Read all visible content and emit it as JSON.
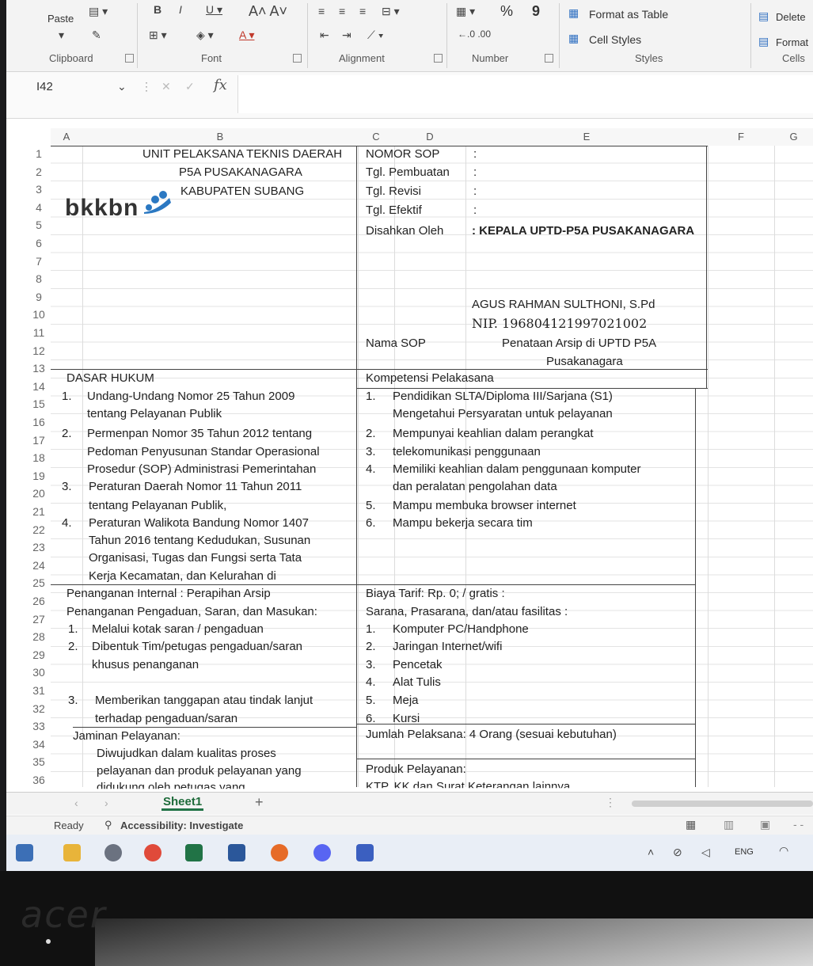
{
  "ribbon": {
    "paste": "Paste",
    "format_as_table": "Format as Table",
    "cell_styles": "Cell Styles",
    "delete": "Delete",
    "format": "Format",
    "groups": [
      "Clipboard",
      "Font",
      "Alignment",
      "Number",
      "Styles",
      "Cells"
    ],
    "number_percent": "%",
    "number_comma": "9"
  },
  "formula_bar": {
    "name_box": "I42",
    "fx": "fx",
    "value": ""
  },
  "columns": [
    "A",
    "B",
    "C",
    "D",
    "E",
    "F",
    "G"
  ],
  "rows": [
    "1",
    "2",
    "3",
    "4",
    "5",
    "6",
    "7",
    "8",
    "9",
    "10",
    "11",
    "12",
    "13",
    "14",
    "15",
    "16",
    "17",
    "18",
    "19",
    "20",
    "21",
    "22",
    "23",
    "24",
    "25",
    "26",
    "27",
    "28",
    "29",
    "30",
    "31",
    "32",
    "33",
    "34",
    "35",
    "36"
  ],
  "header": {
    "org_line1": "UNIT PELAKSANA  TEKNIS DAERAH",
    "org_line2": "P5A PUSAKANAGARA",
    "org_line3": "KABUPATEN SUBANG",
    "logo_text": "bkkbn"
  },
  "sop_info": {
    "nomor_label": "NOMOR SOP",
    "nomor_value": ":",
    "pembuatan_label": "Tgl. Pembuatan",
    "pembuatan_value": ":",
    "revisi_label": "Tgl. Revisi",
    "revisi_value": ":",
    "efektif_label": "Tgl. Efektif",
    "efektif_value": ":",
    "disahkan_label": "Disahkan Oleh",
    "disahkan_value": ": KEPALA UPTD-P5A PUSAKANAGARA",
    "signer_name": "AGUS RAHMAN SULTHONI, S.Pd",
    "signer_nip": "NIP. 196804121997021002",
    "nama_label": "Nama SOP",
    "nama_line1": "Penataan Arsip di UPTD P5A",
    "nama_line2": "Pusakanagara"
  },
  "left": {
    "dasar_hukum": "DASAR HUKUM",
    "r14_no": "1.",
    "r14": "Undang-Undang Nomor 25 Tahun 2009",
    "r15": "tentang Pelayanan Publik",
    "r16_no": "2.",
    "r16": "Permenpan Nomor 35 Tahun 2012 tentang",
    "r17": "Pedoman Penyusunan Standar Operasional",
    "r18": "Prosedur (SOP) Administrasi Pemerintahan",
    "r19_no": "3.",
    "r19": "Peraturan Daerah Nomor 11 Tahun 2011",
    "r20": "tentang Pelayanan Publik,",
    "r21_no": "4.",
    "r21": "Peraturan Walikota Bandung Nomor 1407",
    "r22": "Tahun 2016 tentang Kedudukan, Susunan",
    "r23": "Organisasi, Tugas dan Fungsi serta Tata",
    "r24": "Kerja Kecamatan, dan Kelurahan di",
    "r25": "Penanganan Internal : Perapihan Arsip",
    "r26": "Penanganan Pengaduan, Saran, dan Masukan:",
    "r27_no": "1.",
    "r27": "Melalui kotak saran / pengaduan",
    "r28_no": "2.",
    "r28": "Dibentuk Tim/petugas pengaduan/saran",
    "r29": "khusus penanganan",
    "r31_no": "3.",
    "r31": "Memberikan tanggapan atau tindak lanjut",
    "r32": "terhadap pengaduan/saran",
    "r33": "Jaminan Pelayanan:",
    "r34": "Diwujudkan dalam kualitas proses",
    "r35": "pelayanan dan produk pelayanan yang",
    "r36": "didukung oleh petugas yang"
  },
  "right": {
    "kompetensi": "Kompetensi Pelakasana",
    "r14_no": "1.",
    "r14": "Pendidikan SLTA/Diploma III/Sarjana (S1)",
    "r15": "Mengetahui Persyaratan untuk pelayanan",
    "r16_no": "2.",
    "r16": "Mempunyai keahlian dalam perangkat",
    "r17_no": "3.",
    "r17": "telekomunikasi penggunaan",
    "r18_no": "4.",
    "r18": "Memiliki keahlian dalam penggunaan komputer",
    "r19": "dan peralatan pengolahan data",
    "r20_no": "5.",
    "r20": "Mampu membuka browser internet",
    "r21_no": "6.",
    "r21": "Mampu bekerja secara tim",
    "r25": "Biaya Tarif: Rp. 0; / gratis :",
    "r26": "Sarana, Prasarana, dan/atau fasilitas :",
    "r27_no": "1.",
    "r27": "Komputer PC/Handphone",
    "r28_no": "2.",
    "r28": " Jaringan Internet/wifi",
    "r29_no": "3.",
    "r29": "Pencetak",
    "r30_no": "4.",
    "r30": "Alat Tulis",
    "r31_no": "5.",
    "r31": "Meja",
    "r32_no": "6.",
    "r32": "Kursi",
    "r33": "Jumlah Pelaksana: 4 Orang (sesuai kebutuhan)",
    "r35": "Produk Pelayanan:",
    "r36": "KTP, KK dan Surat Keterangan lainnya"
  },
  "sheet_tabs": {
    "active": "Sheet1",
    "add": "+"
  },
  "status": {
    "ready": "Ready",
    "accessibility": "Accessibility: Investigate"
  },
  "taskbar": {
    "lang": "ENG"
  },
  "bezel": {
    "brand": "acer"
  },
  "colors": {
    "excel_green": "#217346",
    "bkkbn_blue": "#2b78c2"
  }
}
